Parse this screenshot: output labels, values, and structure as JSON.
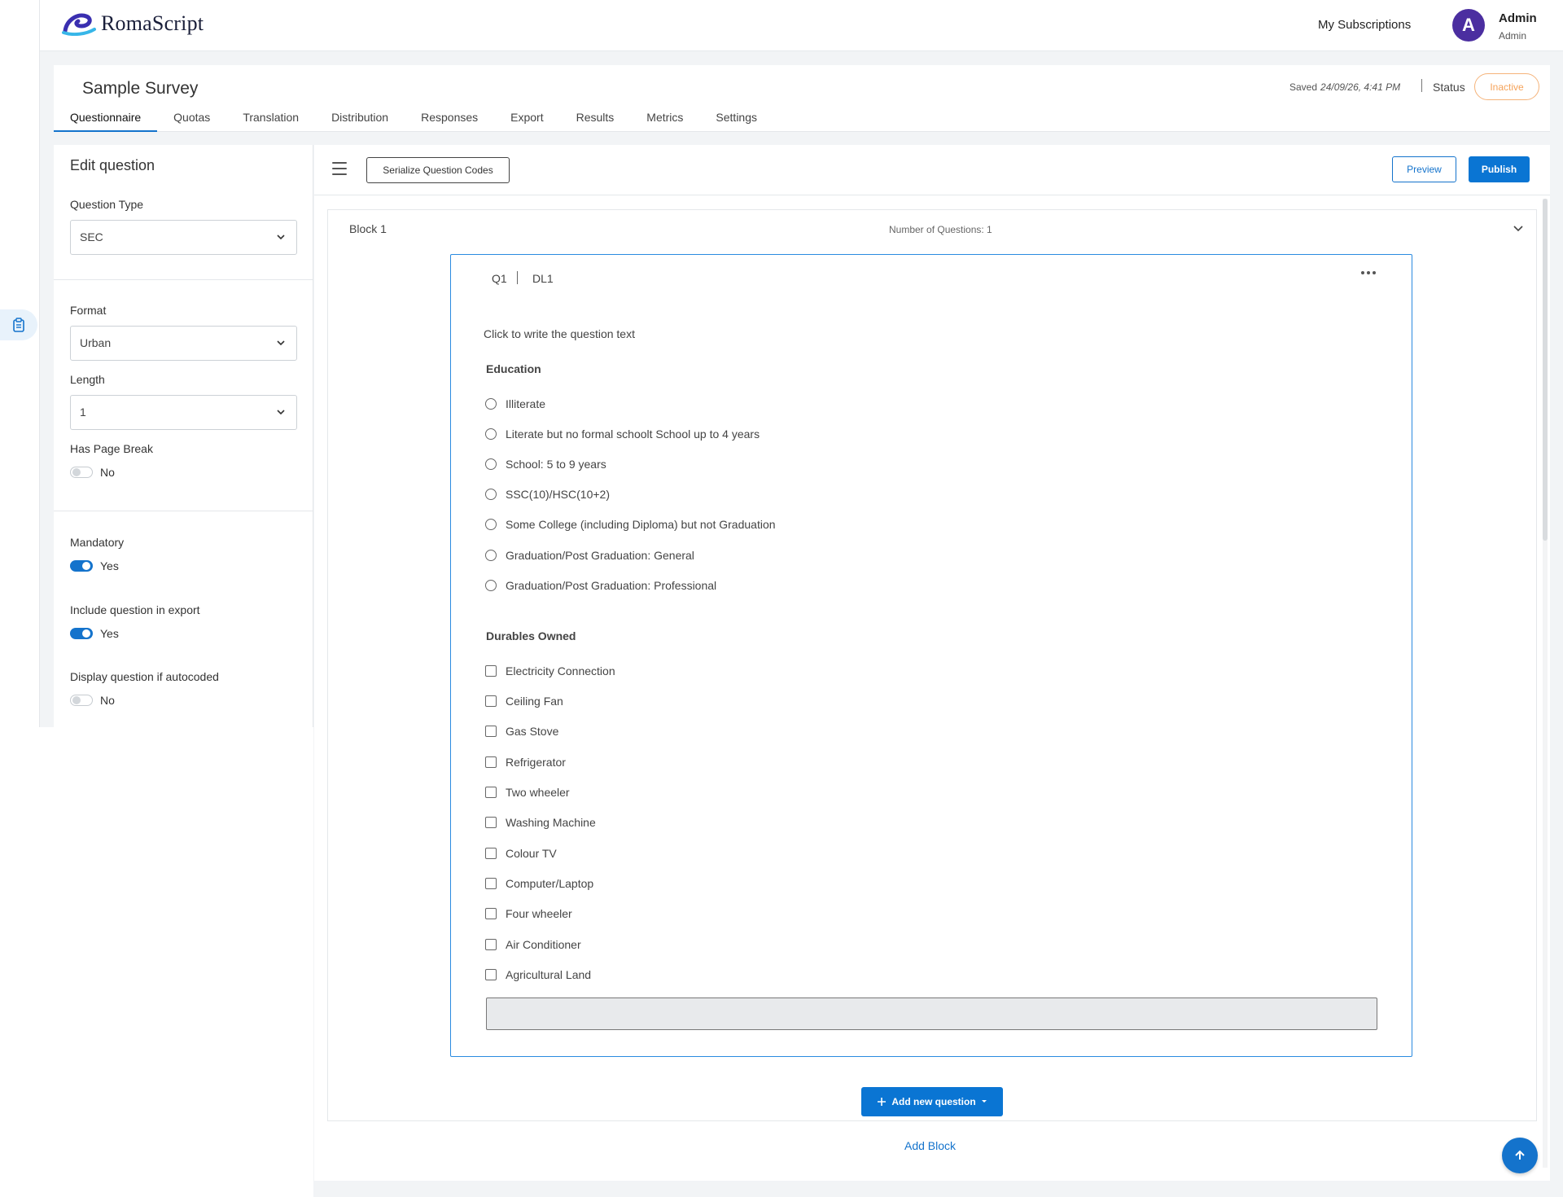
{
  "app": {
    "brand": "RomaScript"
  },
  "header": {
    "subscriptions_label": "My Subscriptions",
    "avatar_initial": "A",
    "user_name": "Admin",
    "user_role": "Admin"
  },
  "survey": {
    "title": "Sample Survey",
    "saved_label": "Saved",
    "saved_time": "24/09/26, 4:41 PM",
    "status_label": "Status",
    "status_value": "Inactive",
    "tabs": [
      {
        "label": "Questionnaire",
        "active": true
      },
      {
        "label": "Quotas"
      },
      {
        "label": "Translation"
      },
      {
        "label": "Distribution"
      },
      {
        "label": "Responses"
      },
      {
        "label": "Export"
      },
      {
        "label": "Results"
      },
      {
        "label": "Metrics"
      },
      {
        "label": "Settings"
      }
    ]
  },
  "edit_panel": {
    "title": "Edit question",
    "question_type_label": "Question Type",
    "question_type_value": "SEC",
    "format_label": "Format",
    "format_value": "Urban",
    "length_label": "Length",
    "length_value": "1",
    "page_break_label": "Has Page Break",
    "page_break_value": "No",
    "mandatory_label": "Mandatory",
    "mandatory_value": "Yes",
    "export_label": "Include question in export",
    "export_value": "Yes",
    "autocoded_label": "Display question if autocoded",
    "autocoded_value": "No"
  },
  "toolbar": {
    "serialize_label": "Serialize Question Codes",
    "preview_label": "Preview",
    "publish_label": "Publish"
  },
  "block": {
    "title": "Block 1",
    "count_text": "Number of Questions: 1"
  },
  "question": {
    "code": "Q1",
    "label": "DL1",
    "text_placeholder": "Click to write the question text",
    "education": {
      "heading": "Education",
      "options": [
        "Illiterate",
        "Literate but no formal schoolt School up to 4 years",
        "School: 5 to 9 years",
        "SSC(10)/HSC(10+2)",
        "Some College (including Diploma) but not Graduation",
        "Graduation/Post Graduation: General",
        "Graduation/Post Graduation: Professional"
      ]
    },
    "durables": {
      "heading": "Durables Owned",
      "options": [
        "Electricity Connection",
        "Ceiling Fan",
        "Gas Stove",
        "Refrigerator",
        "Two wheeler",
        "Washing Machine",
        "Colour TV",
        "Computer/Laptop",
        "Four wheeler",
        "Air Conditioner",
        "Agricultural Land"
      ]
    }
  },
  "footer": {
    "add_question_label": "Add new question",
    "add_block_label": "Add Block"
  },
  "colors": {
    "accent": "#1473cc",
    "status_inactive": "#f5a35a",
    "avatar": "#4b2ea0"
  }
}
